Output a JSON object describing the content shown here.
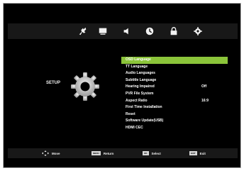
{
  "tabs": [
    {
      "name": "picture-icon"
    },
    {
      "name": "screen-icon"
    },
    {
      "name": "sound-icon"
    },
    {
      "name": "clock-icon"
    },
    {
      "name": "lock-icon"
    },
    {
      "name": "setup-gear-icon"
    }
  ],
  "section": {
    "title": "SETUP",
    "icon": "gear-icon"
  },
  "menu": {
    "items": [
      {
        "label": "OSD Language",
        "value": ""
      },
      {
        "label": "TT Language",
        "value": ""
      },
      {
        "label": "Audio Languages",
        "value": ""
      },
      {
        "label": "Subtitle Language",
        "value": ""
      },
      {
        "label": "Hearing Impaired",
        "value": "Off"
      },
      {
        "label": "PVR File System",
        "value": ""
      },
      {
        "label": "Aspect Ratio",
        "value": "16:9"
      },
      {
        "label": "First Time Installation",
        "value": ""
      },
      {
        "label": "Reset",
        "value": ""
      },
      {
        "label": "Software Update(USB)",
        "value": ""
      },
      {
        "label": "HDMI CEC",
        "value": ""
      }
    ],
    "selected_index": 0
  },
  "hints": {
    "move": {
      "icon": "arrows-icon",
      "label": "Move"
    },
    "return": {
      "key": "MENU",
      "label": "Return"
    },
    "select": {
      "key": "OK",
      "label": "Select"
    },
    "exit": {
      "key": "EXIT",
      "label": "Exit"
    }
  },
  "colors": {
    "background": "#000000",
    "bar": "#181818",
    "highlight": "#8bc43a",
    "text": "#ffffff"
  }
}
